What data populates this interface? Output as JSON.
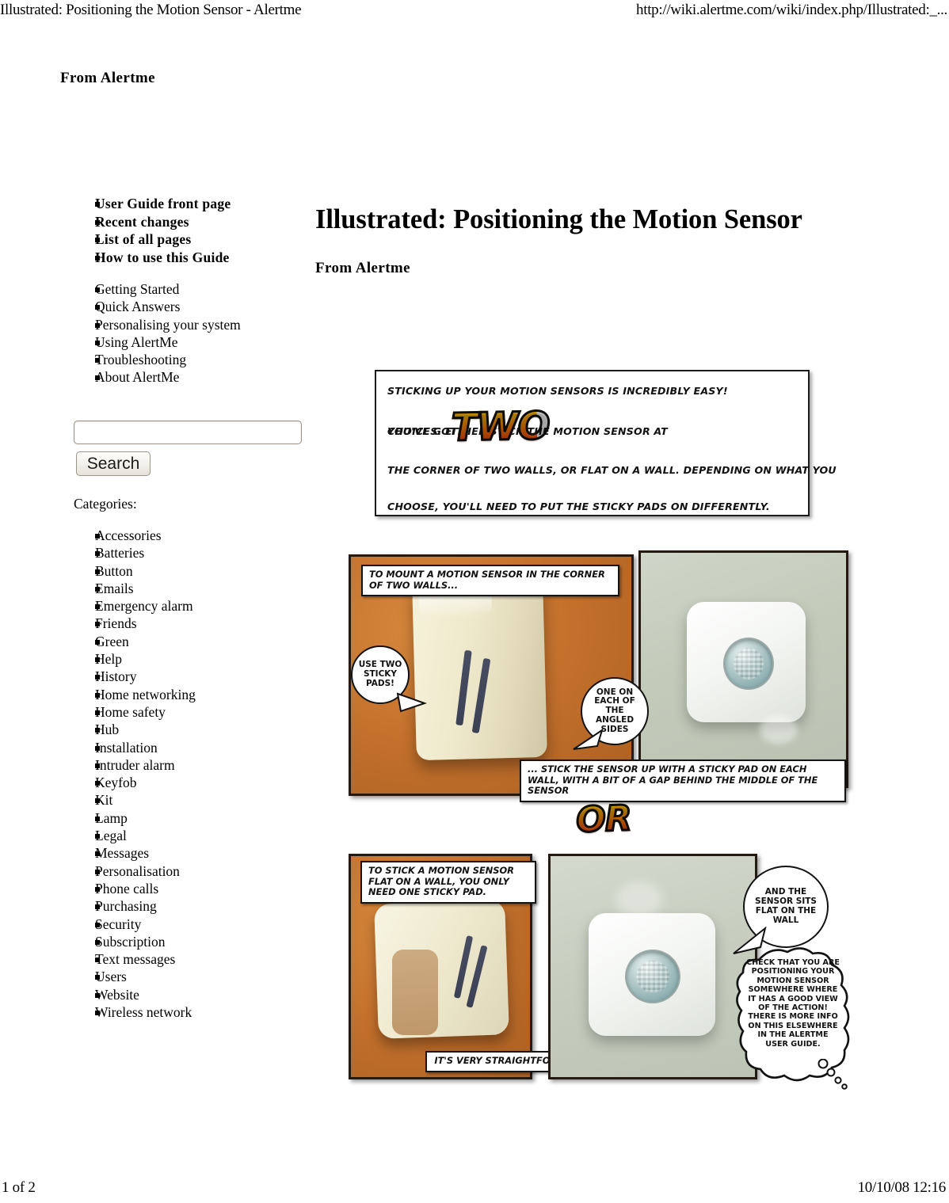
{
  "print_header": {
    "title": "Illustrated: Positioning the Motion Sensor - Alertme",
    "url": "http://wiki.alertme.com/wiki/index.php/Illustrated:_..."
  },
  "print_footer": {
    "page": "1 of 2",
    "timestamp": "10/10/08 12:16"
  },
  "top_attribution": "From Alertme",
  "sidebar": {
    "primary_nav": [
      {
        "label": "User Guide front page"
      },
      {
        "label": "Recent changes"
      },
      {
        "label": "List of all pages"
      },
      {
        "label": "How to use this Guide"
      }
    ],
    "secondary_nav": [
      {
        "label": "Getting Started"
      },
      {
        "label": "Quick Answers"
      },
      {
        "label": "Personalising your system"
      },
      {
        "label": "Using AlertMe"
      },
      {
        "label": "Troubleshooting"
      },
      {
        "label": "About AlertMe"
      }
    ],
    "search": {
      "value": "",
      "placeholder": "",
      "button_label": "Search"
    },
    "categories_label": "Categories:",
    "categories": [
      {
        "label": "Accessories"
      },
      {
        "label": "Batteries"
      },
      {
        "label": "Button"
      },
      {
        "label": "Emails"
      },
      {
        "label": "Emergency alarm"
      },
      {
        "label": "Friends"
      },
      {
        "label": "Green"
      },
      {
        "label": "Help"
      },
      {
        "label": "History"
      },
      {
        "label": "Home networking"
      },
      {
        "label": "Home safety"
      },
      {
        "label": "Hub"
      },
      {
        "label": "Installation"
      },
      {
        "label": "Intruder alarm"
      },
      {
        "label": "Keyfob"
      },
      {
        "label": "Kit"
      },
      {
        "label": "Lamp"
      },
      {
        "label": "Legal"
      },
      {
        "label": "Messages"
      },
      {
        "label": "Personalisation"
      },
      {
        "label": "Phone calls"
      },
      {
        "label": "Purchasing"
      },
      {
        "label": "Security"
      },
      {
        "label": "Subscription"
      },
      {
        "label": "Text messages"
      },
      {
        "label": "Users"
      },
      {
        "label": "Website"
      },
      {
        "label": "Wireless network"
      }
    ]
  },
  "main": {
    "title": "Illustrated: Positioning the Motion Sensor",
    "attribution": "From Alertme"
  },
  "comic": {
    "intro_panel": {
      "line1": "STICKING UP YOUR MOTION SENSORS IS INCREDIBLY EASY!",
      "line2a": "YOU'VE GOT",
      "burst": "TWO",
      "line2b": "CHOICES. EITHER STICK THE MOTION SENSOR AT",
      "line3": "THE CORNER OF TWO WALLS, OR FLAT ON A WALL. DEPENDING ON WHAT YOU",
      "line4": "CHOOSE, YOU'LL NEED TO PUT THE STICKY PADS ON DIFFERENTLY."
    },
    "corner_section": {
      "caption_top": "TO MOUNT A MOTION SENSOR IN THE CORNER OF TWO WALLS...",
      "bubble_left": "USE TWO STICKY PADS!",
      "bubble_right": "ONE ON EACH OF THE ANGLED SIDES",
      "caption_bottom": "... STICK THE SENSOR UP WITH A STICKY PAD ON EACH WALL, WITH A BIT OF A GAP BEHIND THE MIDDLE OF THE SENSOR"
    },
    "divider_burst": "OR",
    "flat_section": {
      "caption_top": "TO STICK A MOTION SENSOR FLAT ON A WALL, YOU ONLY NEED ONE STICKY PAD.",
      "caption_bottom": "IT'S VERY STRAIGHTFORWARD!",
      "bubble_speech": "AND THE SENSOR SITS FLAT ON THE WALL",
      "bubble_thought": "CHECK THAT YOU ARE POSITIONING YOUR MOTION SENSOR SOMEWHERE WHERE IT HAS A GOOD VIEW OF THE ACTION! THERE IS MORE INFO ON THIS ELSEWHERE IN THE ALERTME USER GUIDE."
    }
  },
  "colors": {
    "orange_backdrop": "#c4712c",
    "wall_green_grey": "#c5ccc0",
    "burst_gradient_start": "#ffd400",
    "burst_gradient_end": "#e8201a",
    "panel_border": "#241a12"
  }
}
